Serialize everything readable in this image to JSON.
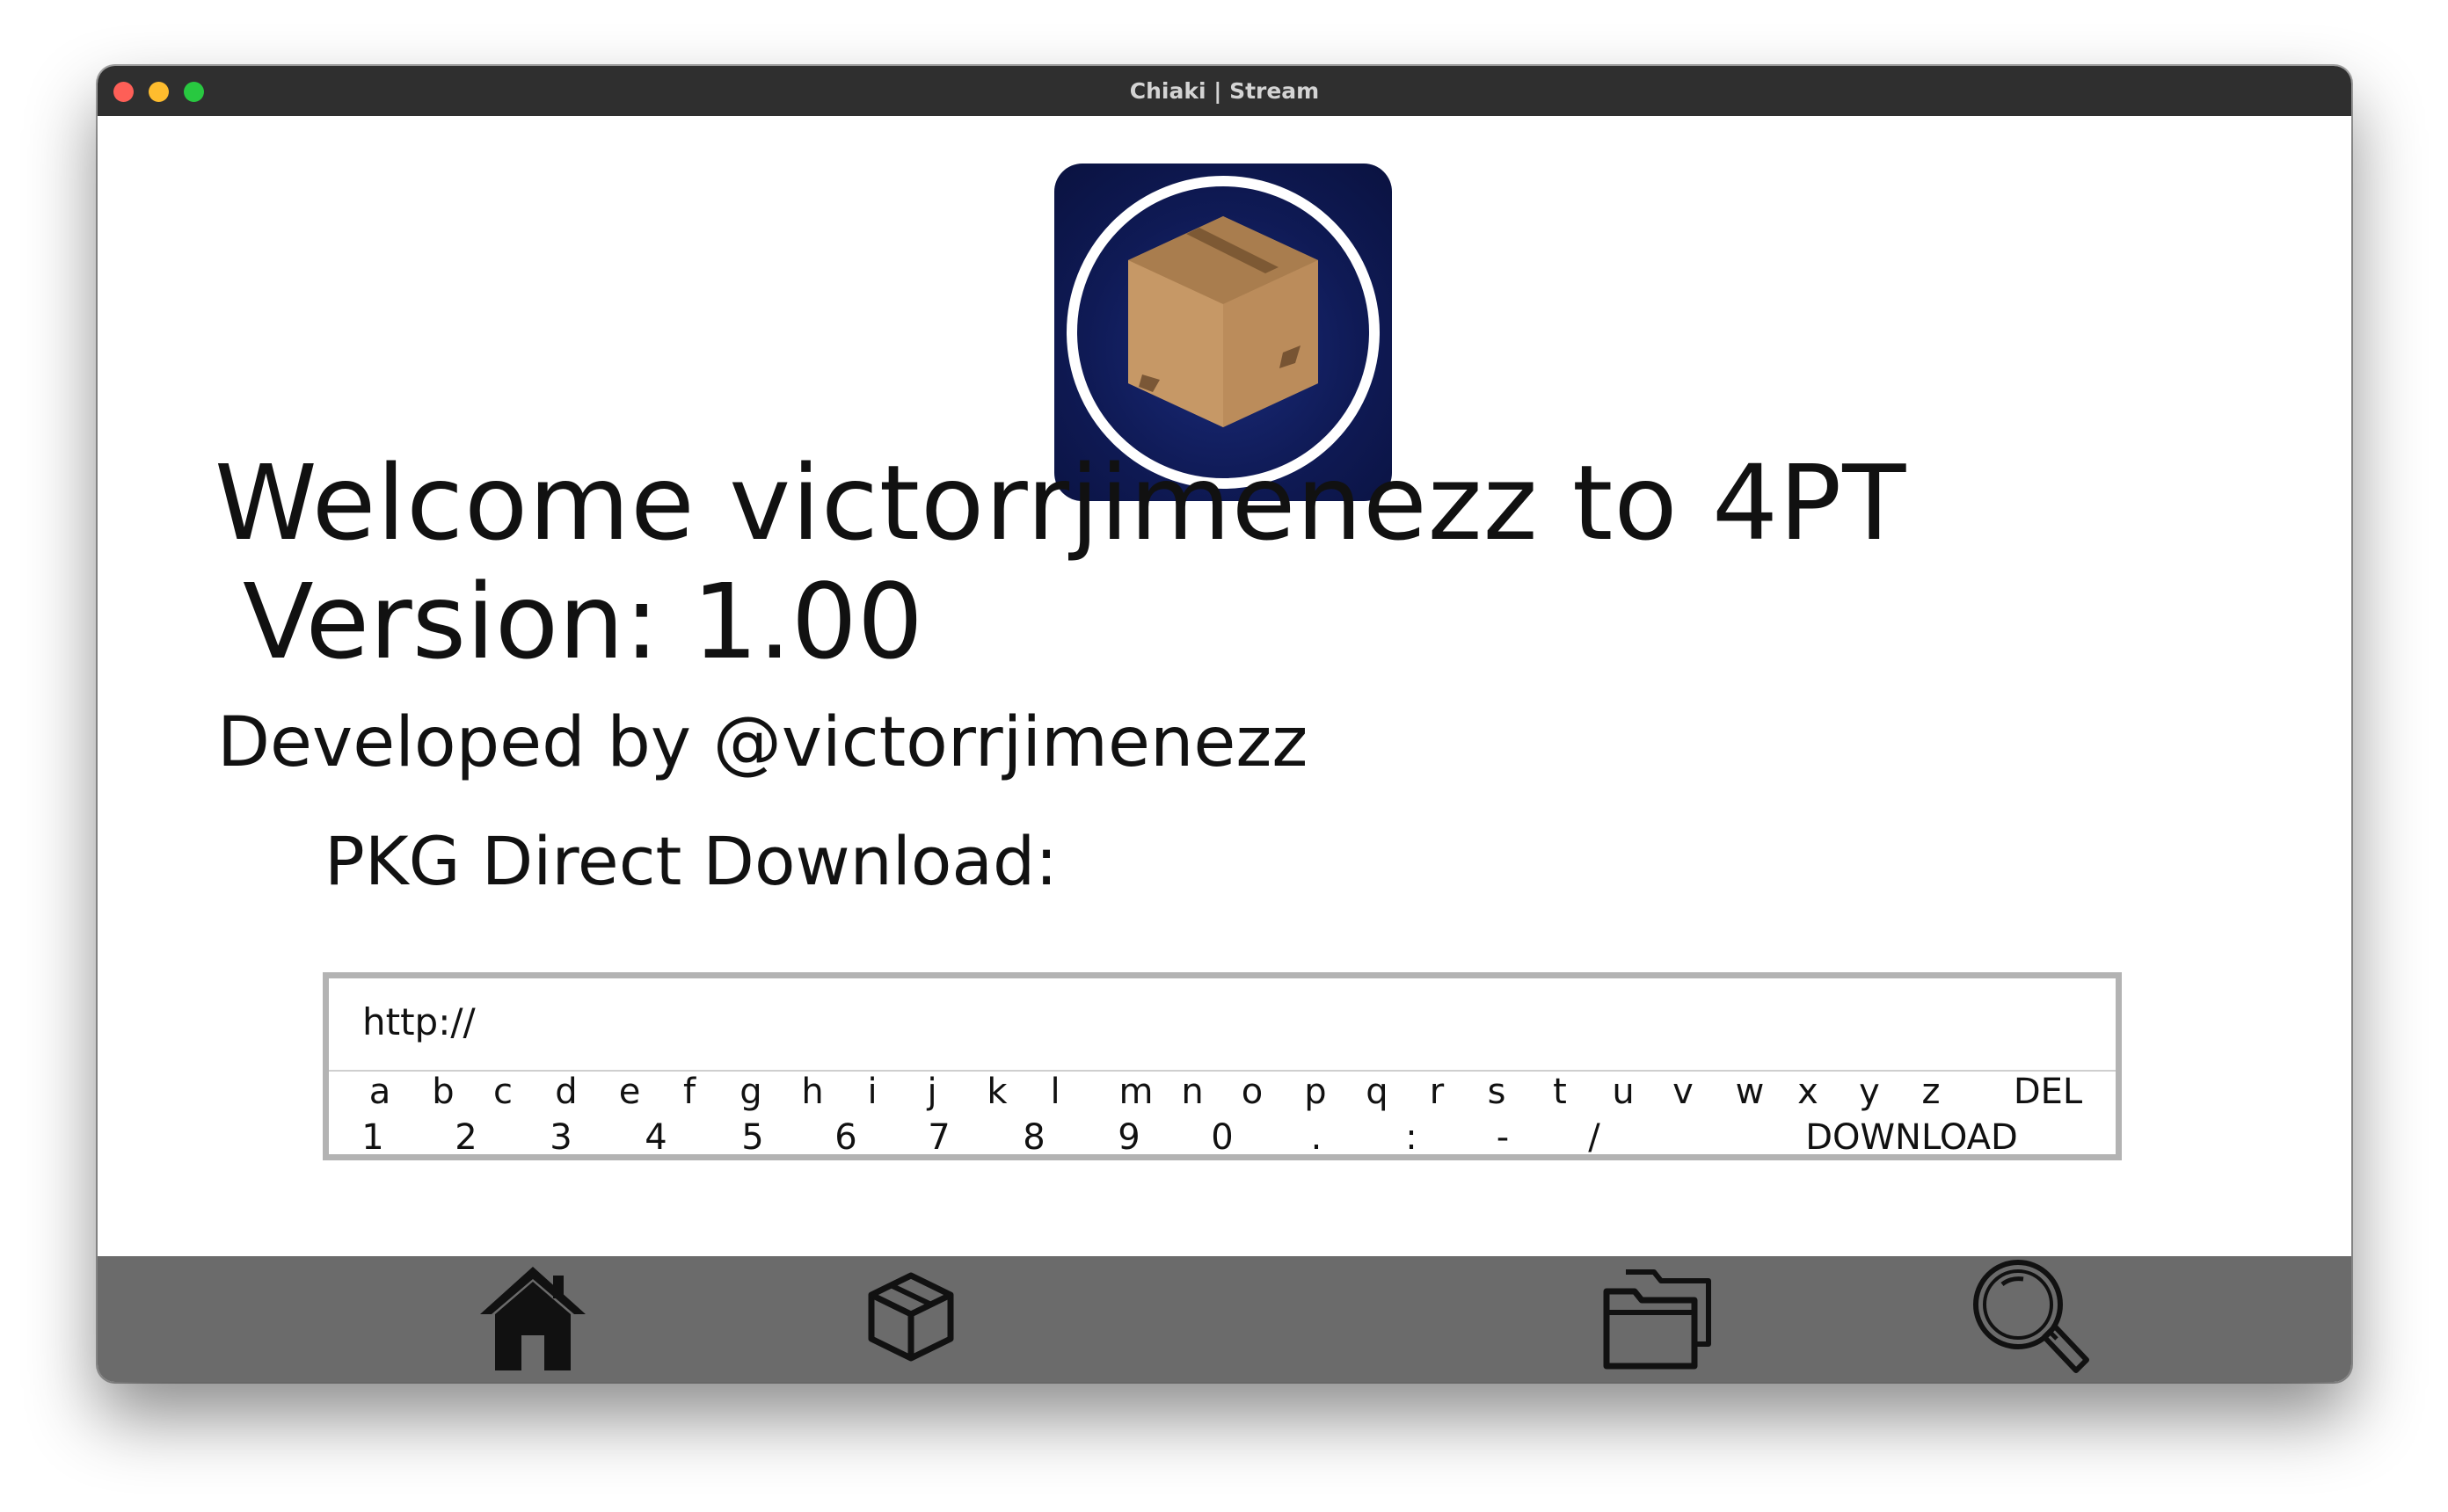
{
  "window": {
    "title": "Chiaki | Stream"
  },
  "app": {
    "icon": "package-box-icon",
    "welcome_line": "Welcome victorrjimenezz to 4PT",
    "version_line": "Version: 1.00",
    "developer_line": "Developed by @victorrjimenezz"
  },
  "downloader": {
    "label": "PKG Direct Download:",
    "url_value": "http://",
    "keyboard_row1": [
      "a",
      "b",
      "c",
      "d",
      "e",
      "f",
      "g",
      "h",
      "i",
      "j",
      "k",
      "l",
      "m",
      "n",
      "o",
      "p",
      "q",
      "r",
      "s",
      "t",
      "u",
      "v",
      "w",
      "x",
      "y",
      "z",
      "DEL"
    ],
    "keyboard_row2": [
      "1",
      "2",
      "3",
      "4",
      "5",
      "6",
      "7",
      "8",
      "9",
      "0",
      ".",
      ":",
      "-",
      "/",
      "DOWNLOAD"
    ]
  },
  "navbar": {
    "items": [
      {
        "icon": "home-icon"
      },
      {
        "icon": "package-icon"
      },
      {
        "icon": "folders-icon"
      },
      {
        "icon": "search-icon"
      }
    ]
  },
  "colors": {
    "titlebar": "#2f2f2f",
    "navbar": "#6b6b6b",
    "icon_background": "#0f1a55",
    "input_border": "#b3b3b3"
  }
}
